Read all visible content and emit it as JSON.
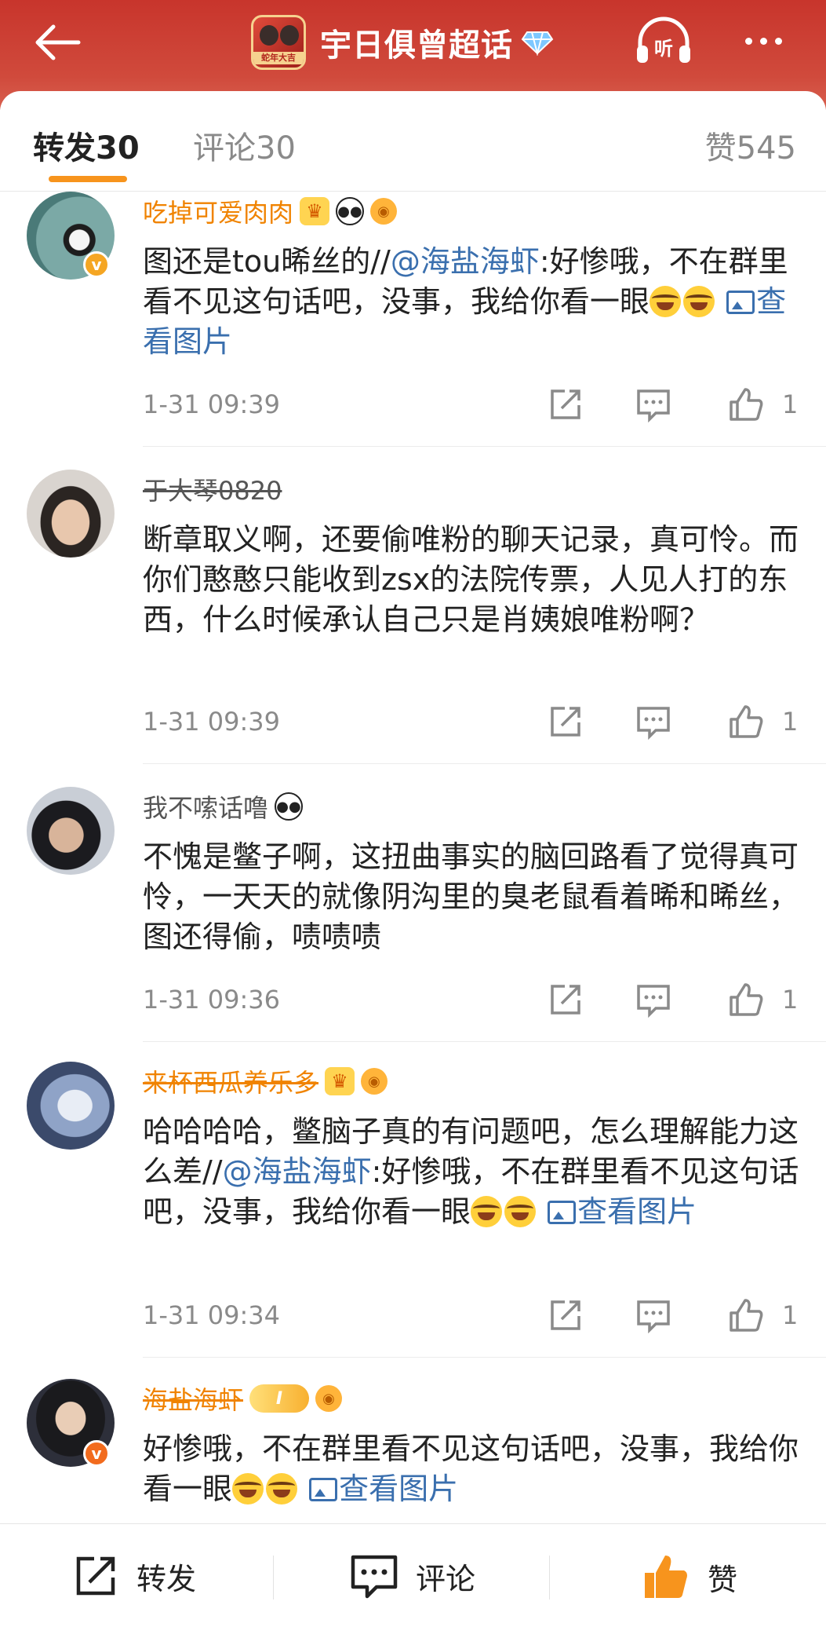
{
  "header": {
    "title": "宇日俱曾超话",
    "topic_avatar_text": "蛇年大吉",
    "accent": "#c8352c"
  },
  "tabs": {
    "forward_label": "转发",
    "forward_count": "30",
    "comment_label": "评论",
    "comment_count": "30",
    "like_label": "赞",
    "like_count": "545"
  },
  "comments": [
    {
      "name": "吃掉可爱肉肉",
      "text_1": "图还是tou晞丝的//",
      "mention": "@海盐海虾",
      "text_2": ":好惨哦，不在群里看不见这句话吧，没事，我给你看一眼",
      "picture_link": "查看图片",
      "time": "1-31 09:39",
      "likes": "1"
    },
    {
      "name": "于大琴0820",
      "text_1": "断章取义啊，还要偷唯粉的聊天记录，真可怜。而你们憨憨只能收到zsx的法院传票，人见人打的东西，什么时候承认自己只是肖姨娘唯粉啊？",
      "time": "1-31 09:39",
      "likes": "1"
    },
    {
      "name": "我不嗦话噜",
      "text_1": "不愧是鳖子啊，这扭曲事实的脑回路看了觉得真可怜，一天天的就像阴沟里的臭老鼠看着晞和晞丝，图还得偷，啧啧啧",
      "time": "1-31 09:36",
      "likes": "1"
    },
    {
      "name": "来杯西瓜养乐多",
      "text_1": "哈哈哈哈，鳖脑子真的有问题吧，怎么理解能力这么差//",
      "mention": "@海盐海虾",
      "text_2": ":好惨哦，不在群里看不见这句话吧，没事，我给你看一眼",
      "picture_link": "查看图片",
      "time": "1-31 09:34",
      "likes": "1"
    },
    {
      "name": "海盐海虾",
      "level": "I",
      "text_1": "好惨哦，不在群里看不见这句话吧，没事，我给你看一眼",
      "picture_link": "查看图片"
    }
  ],
  "bottom_bar": {
    "forward": "转发",
    "comment": "评论",
    "like": "赞",
    "like_color": "#f7941d"
  }
}
